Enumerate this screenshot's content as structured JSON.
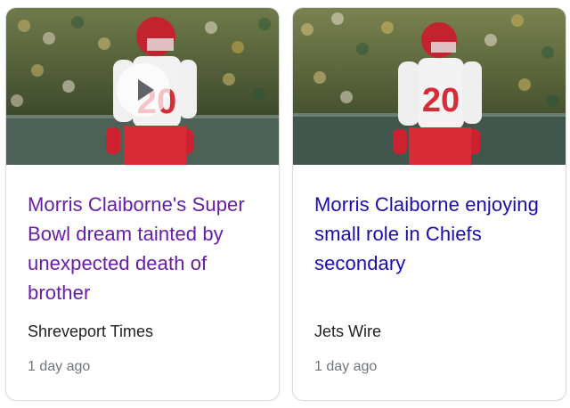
{
  "cards": [
    {
      "title": "Morris Claiborne's Super Bowl dream tainted by unexpected death of brother",
      "source": "Shreveport Times",
      "time": "1 day ago",
      "has_video": true,
      "jersey_number": "20",
      "title_color": "#681da8"
    },
    {
      "title": "Morris Claiborne enjoying small role in Chiefs secondary",
      "source": "Jets Wire",
      "time": "1 day ago",
      "has_video": false,
      "jersey_number": "20",
      "title_color": "#1a0dab"
    }
  ]
}
